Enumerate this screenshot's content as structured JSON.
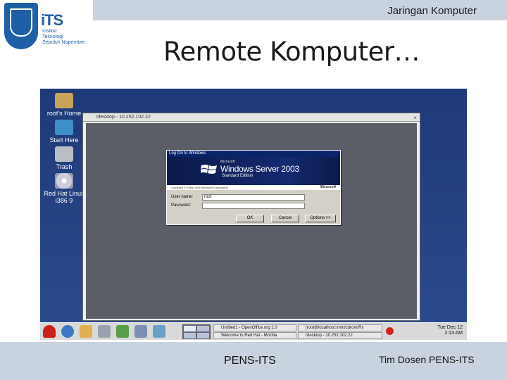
{
  "header": {
    "course_title": "Jaringan Komputer",
    "logo": {
      "name": "iTS",
      "subtitle_lines": [
        "Institut",
        "Teknologi",
        "Sepuluh Nopember"
      ]
    }
  },
  "slide": {
    "title": "Remote Komputer…"
  },
  "screenshot": {
    "desktop_icons": [
      {
        "label": "root's Home",
        "icon": "home-folder-icon"
      },
      {
        "label": "Start Here",
        "icon": "start-here-icon"
      },
      {
        "label": "Trash",
        "icon": "trash-icon"
      },
      {
        "label": "Red Hat Linux i386 9",
        "icon": "cdrom-icon"
      }
    ],
    "rdesktop_window": {
      "title": "rdesktop - 10.252.102.22",
      "close_glyph": "×"
    },
    "logon_dialog": {
      "title": "Log On to Windows",
      "brand_small": "Microsoft",
      "product": "Windows Server",
      "product_year": "2003",
      "edition": "Standard Edition",
      "copyright": "Copyright © 1985-2003 Microsoft Corporation",
      "ms_logo": "Microsoft",
      "username_label": "User name:",
      "username_value": "root",
      "password_label": "Password:",
      "password_value": "",
      "ok_label": "OK",
      "cancel_label": "Cancel",
      "options_label": "Options >>"
    },
    "taskbar": {
      "tasks": [
        "Untitled1 - OpenOffice.org 1.0",
        "[root@localhost:/mnt/cdrom/Rx",
        "Welcome to Red Hat - Mozilla",
        "rdesktop - 10.252.102.22"
      ],
      "clock_day": "Tue Dec 12",
      "clock_time": "2:13 AM"
    }
  },
  "footer": {
    "center": "PENS-ITS",
    "right": "Tim Dosen PENS-ITS"
  },
  "colors": {
    "band": "#c9d3e0",
    "desktop": "#1f3a78",
    "logon_title": "#0a246a",
    "logo_blue": "#1f5fa8"
  }
}
